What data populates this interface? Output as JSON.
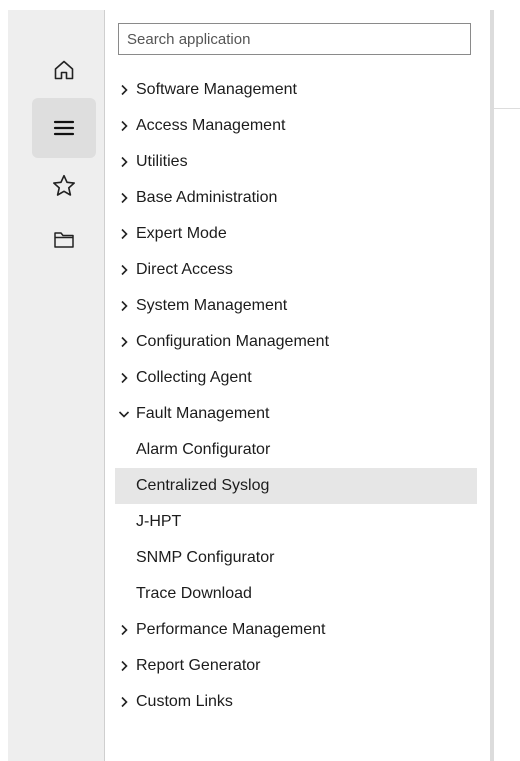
{
  "rail": {
    "items": [
      {
        "icon": "home-icon",
        "active": false
      },
      {
        "icon": "menu-icon",
        "active": true
      },
      {
        "icon": "star-icon",
        "active": false
      },
      {
        "icon": "folder-icon",
        "active": false
      }
    ]
  },
  "search": {
    "placeholder": "Search application",
    "value": ""
  },
  "tree": {
    "items": [
      {
        "label": "Software Management",
        "expandable": true,
        "expanded": false
      },
      {
        "label": "Access Management",
        "expandable": true,
        "expanded": false
      },
      {
        "label": "Utilities",
        "expandable": true,
        "expanded": false
      },
      {
        "label": "Base Administration",
        "expandable": true,
        "expanded": false
      },
      {
        "label": "Expert Mode",
        "expandable": true,
        "expanded": false
      },
      {
        "label": "Direct Access",
        "expandable": true,
        "expanded": false
      },
      {
        "label": "System Management",
        "expandable": true,
        "expanded": false
      },
      {
        "label": "Configuration Management",
        "expandable": true,
        "expanded": false
      },
      {
        "label": "Collecting Agent",
        "expandable": true,
        "expanded": false
      },
      {
        "label": "Fault Management",
        "expandable": true,
        "expanded": true
      },
      {
        "label": "Alarm Configurator",
        "child": true
      },
      {
        "label": "Centralized Syslog",
        "child": true,
        "selected": true
      },
      {
        "label": "J-HPT",
        "child": true
      },
      {
        "label": "SNMP Configurator",
        "child": true
      },
      {
        "label": "Trace Download",
        "child": true
      },
      {
        "label": "Performance Management",
        "expandable": true,
        "expanded": false
      },
      {
        "label": "Report Generator",
        "expandable": true,
        "expanded": false
      },
      {
        "label": "Custom Links",
        "expandable": true,
        "expanded": false
      }
    ]
  },
  "colors": {
    "rail_background": "#eeeeee",
    "active_button": "#dedede",
    "selected_row": "#e6e6e6",
    "text": "#1c1c1c"
  }
}
